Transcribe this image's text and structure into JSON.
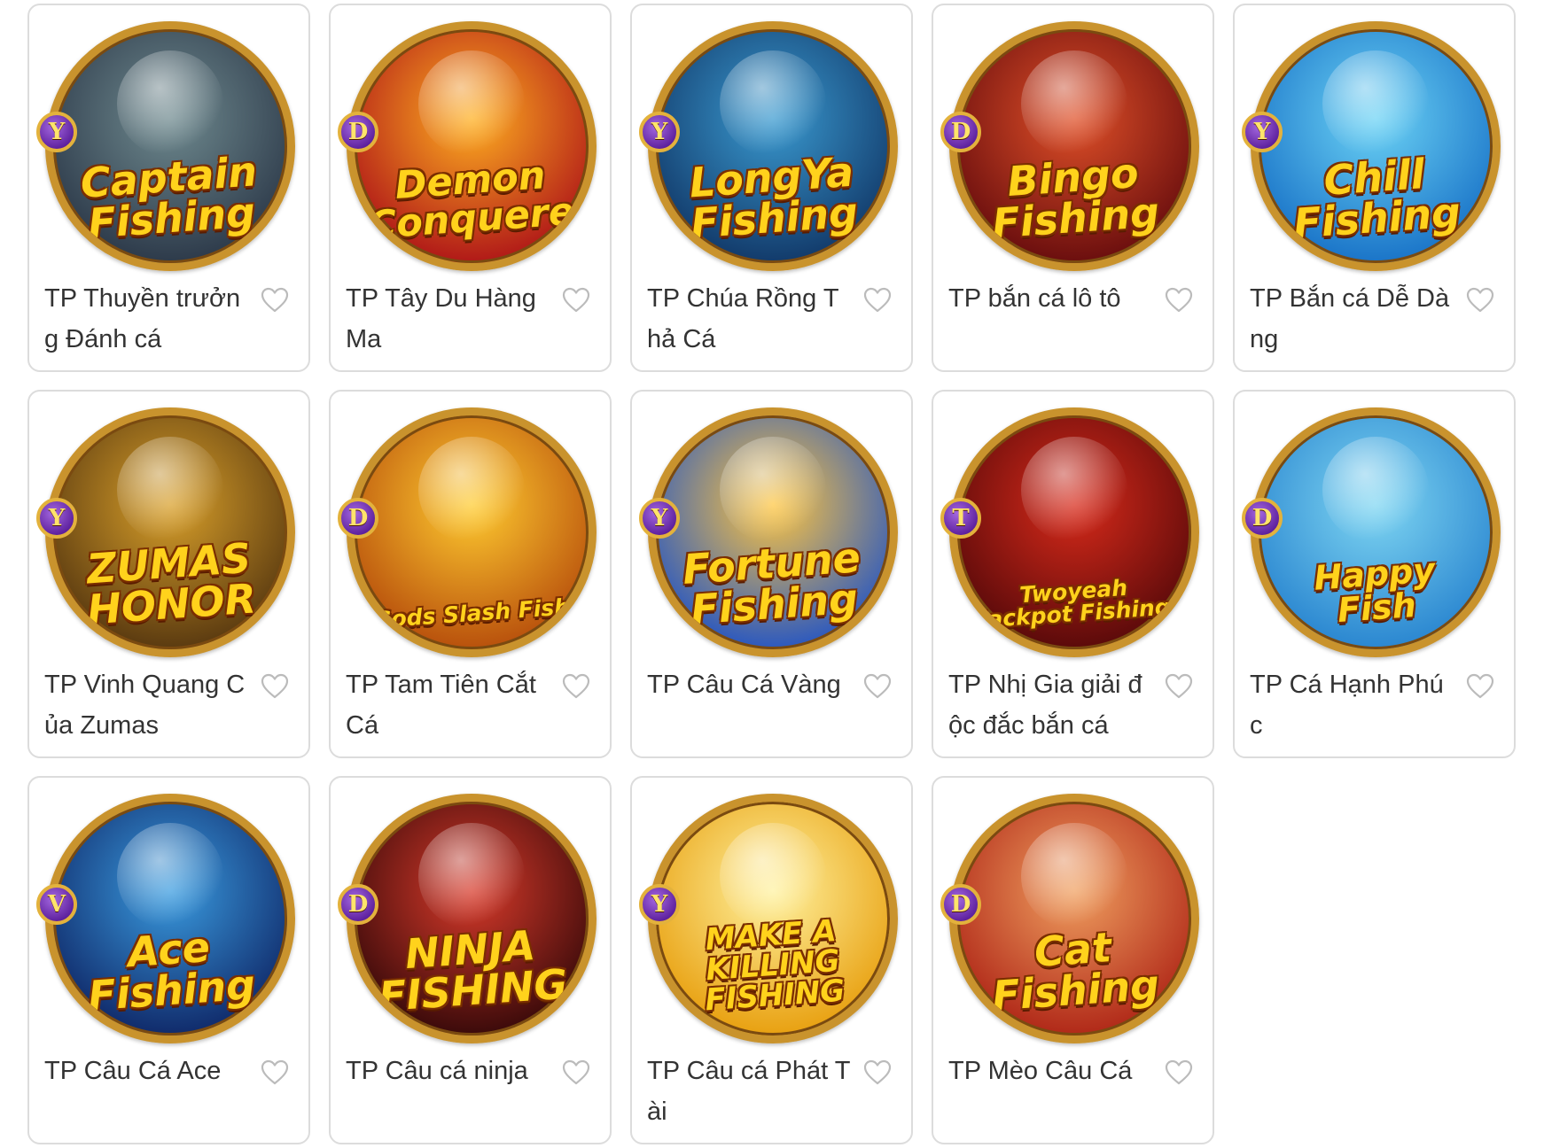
{
  "colors": {
    "card_border": "#dcdcdc",
    "name_text": "#333333",
    "heart_outline": "#bbbbbb",
    "badge_purple": "#6a2aa8",
    "badge_gold": "#e3b23c",
    "ring_gold": "#c9932d"
  },
  "favorite_icon": "heart-outline-icon",
  "games": [
    {
      "name": "TP Thuyền trưởng Đánh cá",
      "badge": "Y",
      "art_title": "Captain\nFishing",
      "art_colors": [
        "#6f8a8f",
        "#2d3a4a"
      ]
    },
    {
      "name": "TP Tây Du Hàng Ma",
      "badge": "D",
      "art_title": "Demon\nConquered",
      "art_colors": [
        "#ffb020",
        "#b01818"
      ]
    },
    {
      "name": "TP Chúa Rồng Thả Cá",
      "badge": "Y",
      "art_title": "LongYa\nFishing",
      "art_colors": [
        "#3a9ad0",
        "#123a6a"
      ]
    },
    {
      "name": "TP bắn cá lô tô",
      "badge": "D",
      "art_title": "Bingo\nFishing",
      "art_colors": [
        "#e05028",
        "#6a0e0e"
      ]
    },
    {
      "name": "TP Bắn cá Dễ Dàng",
      "badge": "Y",
      "art_title": "Chill\nFishing",
      "art_colors": [
        "#6cd3f5",
        "#1a74c8"
      ]
    },
    {
      "name": "TP Vinh Quang Của Zumas",
      "badge": "Y",
      "art_title": "ZUMAS\nHONOR",
      "art_colors": [
        "#d9a02a",
        "#5a3a10"
      ]
    },
    {
      "name": "TP Tam Tiên Cắt Cá",
      "badge": "D",
      "art_title": "Gods Slash Fish",
      "art_colors": [
        "#ffcc30",
        "#b8500c"
      ]
    },
    {
      "name": "TP Câu Cá Vàng",
      "badge": "Y",
      "art_title": "Fortune\nFishing",
      "art_colors": [
        "#ffc640",
        "#2a58c0"
      ]
    },
    {
      "name": "TP Nhị Gia giải độc đắc bắn cá",
      "badge": "T",
      "art_title": "Twoyeah\nJackpot Fishing",
      "art_colors": [
        "#d82a1a",
        "#5a0a0a"
      ]
    },
    {
      "name": "TP Cá Hạnh Phúc",
      "badge": "D",
      "art_title": "Happy Fish",
      "art_colors": [
        "#7fd6f2",
        "#2a86d0"
      ]
    },
    {
      "name": "TP Câu Cá Ace",
      "badge": "V",
      "art_title": "Ace\nFishing",
      "art_colors": [
        "#3a9ce0",
        "#102a6a"
      ]
    },
    {
      "name": "TP Câu cá ninja",
      "badge": "D",
      "art_title": "NINJA\nFISHING",
      "art_colors": [
        "#d83a2a",
        "#3a0a0a"
      ]
    },
    {
      "name": "TP Câu cá Phát Tài",
      "badge": "Y",
      "art_title": "MAKE A\nKILLING\nFISHING",
      "art_colors": [
        "#fff2a0",
        "#e8a010"
      ]
    },
    {
      "name": "TP Mèo Câu Cá",
      "badge": "D",
      "art_title": "Cat\nFishing",
      "art_colors": [
        "#f0a060",
        "#b02818"
      ]
    }
  ]
}
